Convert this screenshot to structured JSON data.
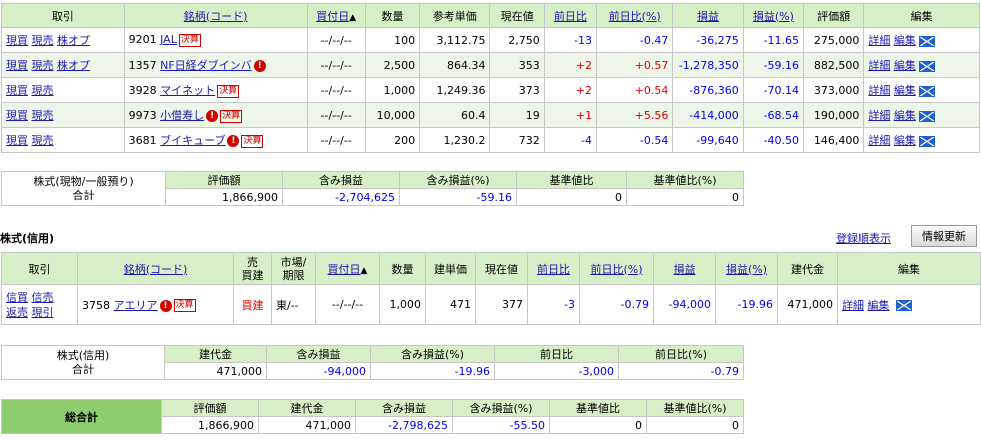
{
  "spot": {
    "headers": [
      "取引",
      "銘柄(コード)",
      "買付日",
      "数量",
      "参考単価",
      "現在値",
      "前日比",
      "前日比(%)",
      "損益",
      "損益(%)",
      "評価額",
      "編集"
    ],
    "sort_mark": "▲",
    "rows": [
      {
        "actions": [
          "現買",
          "現売",
          "株オプ"
        ],
        "code": "9201",
        "name": "JAL",
        "alert": false,
        "kessan": "決算",
        "date": "--/--/--",
        "qty": "100",
        "ref_price": "3,112.75",
        "price": "2,750",
        "chg": "-13",
        "chg_pct": "-0.47",
        "pl": "-36,275",
        "pl_pct": "-11.65",
        "value": "275,000",
        "detail": "詳細",
        "edit": "編集"
      },
      {
        "actions": [
          "現買",
          "現売",
          "株オプ"
        ],
        "code": "1357",
        "name": "NF日経ダブインバ",
        "alert": true,
        "kessan": "",
        "date": "--/--/--",
        "qty": "2,500",
        "ref_price": "864.34",
        "price": "353",
        "chg": "+2",
        "chg_pct": "+0.57",
        "pl": "-1,278,350",
        "pl_pct": "-59.16",
        "value": "882,500",
        "detail": "詳細",
        "edit": "編集"
      },
      {
        "actions": [
          "現買",
          "現売"
        ],
        "code": "3928",
        "name": "マイネット",
        "alert": false,
        "kessan": "決算",
        "date": "--/--/--",
        "qty": "1,000",
        "ref_price": "1,249.36",
        "price": "373",
        "chg": "+2",
        "chg_pct": "+0.54",
        "pl": "-876,360",
        "pl_pct": "-70.14",
        "value": "373,000",
        "detail": "詳細",
        "edit": "編集"
      },
      {
        "actions": [
          "現買",
          "現売"
        ],
        "code": "9973",
        "name": "小僧寿し",
        "alert": true,
        "kessan": "決算",
        "date": "--/--/--",
        "qty": "10,000",
        "ref_price": "60.4",
        "price": "19",
        "chg": "+1",
        "chg_pct": "+5.56",
        "pl": "-414,000",
        "pl_pct": "-68.54",
        "value": "190,000",
        "detail": "詳細",
        "edit": "編集"
      },
      {
        "actions": [
          "現買",
          "現売"
        ],
        "code": "3681",
        "name": "ブイキューブ",
        "alert": true,
        "kessan": "決算",
        "date": "--/--/--",
        "qty": "200",
        "ref_price": "1,230.2",
        "price": "732",
        "chg": "-4",
        "chg_pct": "-0.54",
        "pl": "-99,640",
        "pl_pct": "-40.50",
        "value": "146,400",
        "detail": "詳細",
        "edit": "編集"
      }
    ]
  },
  "spot_summary": {
    "label_top": "株式(現物/一般預り)",
    "label_bottom": "合計",
    "headers": [
      "評価額",
      "含み損益",
      "含み損益(%)",
      "基準値比",
      "基準値比(%)"
    ],
    "values": [
      "1,866,900",
      "-2,704,625",
      "-59.16",
      "0",
      "0"
    ]
  },
  "margin_section": {
    "title": "株式(信用)",
    "register_link": "登録順表示",
    "refresh_button": "情報更新"
  },
  "margin": {
    "headers": [
      "取引",
      "銘柄(コード)",
      "売\n買建",
      "市場/\n期限",
      "買付日",
      "数量",
      "建単価",
      "現在値",
      "前日比",
      "前日比(%)",
      "損益",
      "損益(%)",
      "建代金",
      "編集"
    ],
    "sort_mark": "▲",
    "row": {
      "actions": [
        "信買",
        "信売",
        "返売",
        "現引"
      ],
      "code": "3758",
      "name": "アエリア",
      "alert": true,
      "kessan": "決算",
      "side": "買建",
      "market": "東/--",
      "date": "--/--/--",
      "qty": "1,000",
      "price_open": "471",
      "price": "377",
      "chg": "-3",
      "chg_pct": "-0.79",
      "pl": "-94,000",
      "pl_pct": "-19.96",
      "amount": "471,000",
      "detail": "詳細",
      "edit": "編集"
    }
  },
  "margin_summary": {
    "label_top": "株式(信用)",
    "label_bottom": "合計",
    "headers": [
      "建代金",
      "含み損益",
      "含み損益(%)",
      "前日比",
      "前日比(%)"
    ],
    "values": [
      "471,000",
      "-94,000",
      "-19.96",
      "-3,000",
      "-0.79"
    ]
  },
  "grand_total": {
    "label": "総合計",
    "headers": [
      "評価額",
      "建代金",
      "含み損益",
      "含み損益(%)",
      "基準値比",
      "基準値比(%)"
    ],
    "values": [
      "1,866,900",
      "471,000",
      "-2,798,625",
      "-55.50",
      "0",
      "0"
    ]
  },
  "colors": {
    "header_bg": "#d7efc6",
    "link": "#1a1ab0",
    "negative": "#0000ee",
    "positive": "#e00000",
    "grand_total_label_bg": "#8dcd70"
  }
}
